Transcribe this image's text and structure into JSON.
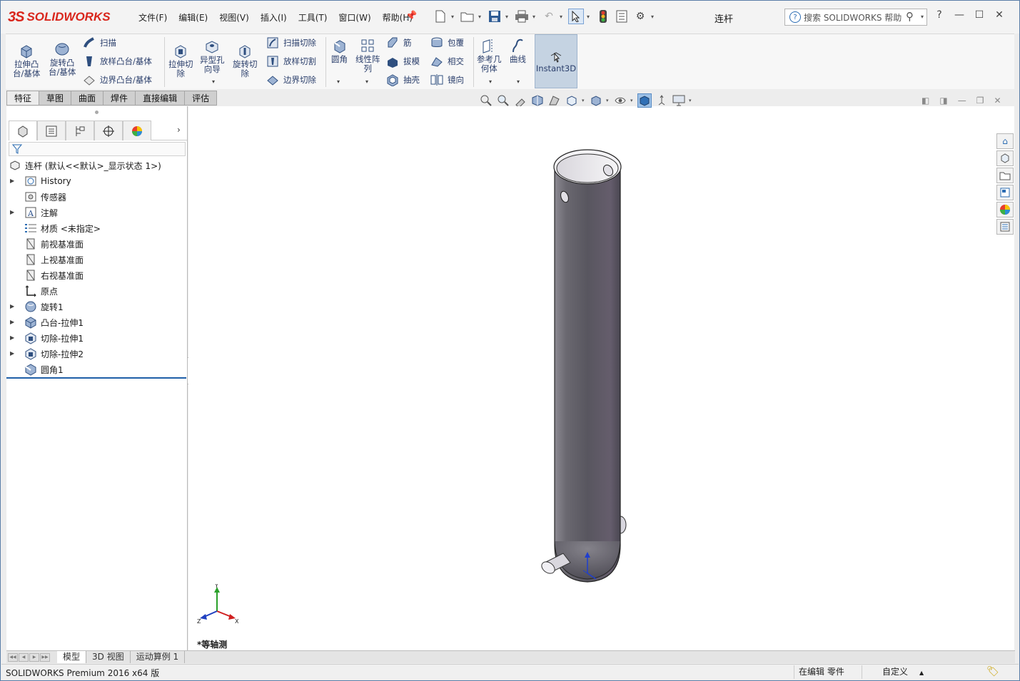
{
  "app": {
    "logo_ds": "3S",
    "logo_text": "SOLIDWORKS",
    "document_title": "连杆"
  },
  "menu": [
    "文件(F)",
    "编辑(E)",
    "视图(V)",
    "插入(I)",
    "工具(T)",
    "窗口(W)",
    "帮助(H)"
  ],
  "search": {
    "placeholder": "搜索 SOLIDWORKS 帮助",
    "help_glyph": "?"
  },
  "window_buttons": {
    "help": "?",
    "minimize": "—",
    "maximize": "☐",
    "close": "✕"
  },
  "ribbon": {
    "extruded_boss": "拉伸凸\n台/基体",
    "revolved_boss": "旋转凸\n台/基体",
    "swept_boss": "扫描",
    "lofted_boss": "放样凸台/基体",
    "boundary_boss": "边界凸台/基体",
    "extruded_cut": "拉伸切\n除",
    "hole_wizard": "异型孔\n向导",
    "revolved_cut": "旋转切\n除",
    "swept_cut": "扫描切除",
    "lofted_cut": "放样切割",
    "boundary_cut": "边界切除",
    "fillet": "圆角",
    "linear_pattern": "线性阵\n列",
    "rib": "筋",
    "draft": "拔模",
    "shell": "抽壳",
    "wrap": "包覆",
    "intersect": "相交",
    "mirror": "镜向",
    "reference_geometry": "参考几\n何体",
    "curves": "曲线",
    "instant3d": "Instant3D"
  },
  "command_tabs": [
    "特征",
    "草图",
    "曲面",
    "焊件",
    "直接编辑",
    "评估"
  ],
  "feature_tree": {
    "root": "连杆  (默认<<默认>_显示状态 1>)",
    "items": [
      {
        "label": "History",
        "expandable": true,
        "icon": "history-icon"
      },
      {
        "label": "传感器",
        "expandable": false,
        "icon": "sensor-icon"
      },
      {
        "label": "注解",
        "expandable": true,
        "icon": "annotation-icon"
      },
      {
        "label": "材质 <未指定>",
        "expandable": false,
        "icon": "material-icon"
      },
      {
        "label": "前视基准面",
        "expandable": false,
        "icon": "plane-icon"
      },
      {
        "label": "上视基准面",
        "expandable": false,
        "icon": "plane-icon"
      },
      {
        "label": "右视基准面",
        "expandable": false,
        "icon": "plane-icon"
      },
      {
        "label": "原点",
        "expandable": false,
        "icon": "origin-icon"
      },
      {
        "label": "旋转1",
        "expandable": true,
        "icon": "revolve-icon"
      },
      {
        "label": "凸台-拉伸1",
        "expandable": true,
        "icon": "extrude-icon"
      },
      {
        "label": "切除-拉伸1",
        "expandable": true,
        "icon": "cut-extrude-icon"
      },
      {
        "label": "切除-拉伸2",
        "expandable": true,
        "icon": "cut-extrude-icon"
      },
      {
        "label": "圆角1",
        "expandable": false,
        "icon": "fillet-icon"
      }
    ]
  },
  "viewport": {
    "view_name": "*等轴测",
    "triad": {
      "x": "X",
      "y": "Y",
      "z": "Z"
    }
  },
  "bottom_tabs": [
    "模型",
    "3D 视图",
    "运动算例 1"
  ],
  "status": {
    "version": "SOLIDWORKS Premium 2016 x64 版",
    "mode": "在编辑 零件",
    "units": "自定义"
  },
  "colors": {
    "brand_red": "#d9261c",
    "accent_blue": "#1f5fa8",
    "part_gray": "#6c6874"
  }
}
